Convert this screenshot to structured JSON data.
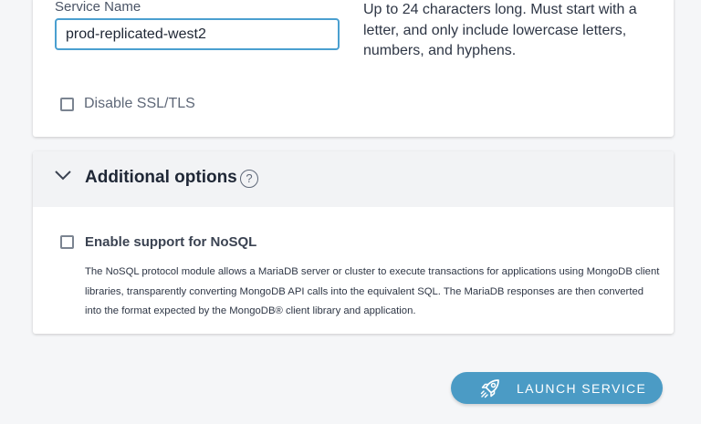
{
  "service": {
    "label": "Service Name",
    "value": "prod-replicated-west2",
    "helper": "Up to 24 characters long. Must start with a letter, and only include lowercase letters, numbers, and hyphens.",
    "disable_ssl_label": "Disable SSL/TLS",
    "disable_ssl_checked": false
  },
  "options": {
    "title": "Additional options",
    "help_icon": "?",
    "nosql_label": "Enable support for NoSQL",
    "nosql_checked": false,
    "nosql_description": "The NoSQL protocol module allows a MariaDB server or cluster to execute transactions for applications using MongoDB client libraries, transparently converting MongoDB API calls into the equivalent SQL. The MariaDB responses are then converted into the format expected by the MongoDB® client library and application."
  },
  "launch": {
    "label": "LAUNCH SERVICE",
    "icon": "rocket-icon"
  },
  "colors": {
    "accent": "#4b9bc5",
    "input_border": "#4a9fd0"
  }
}
